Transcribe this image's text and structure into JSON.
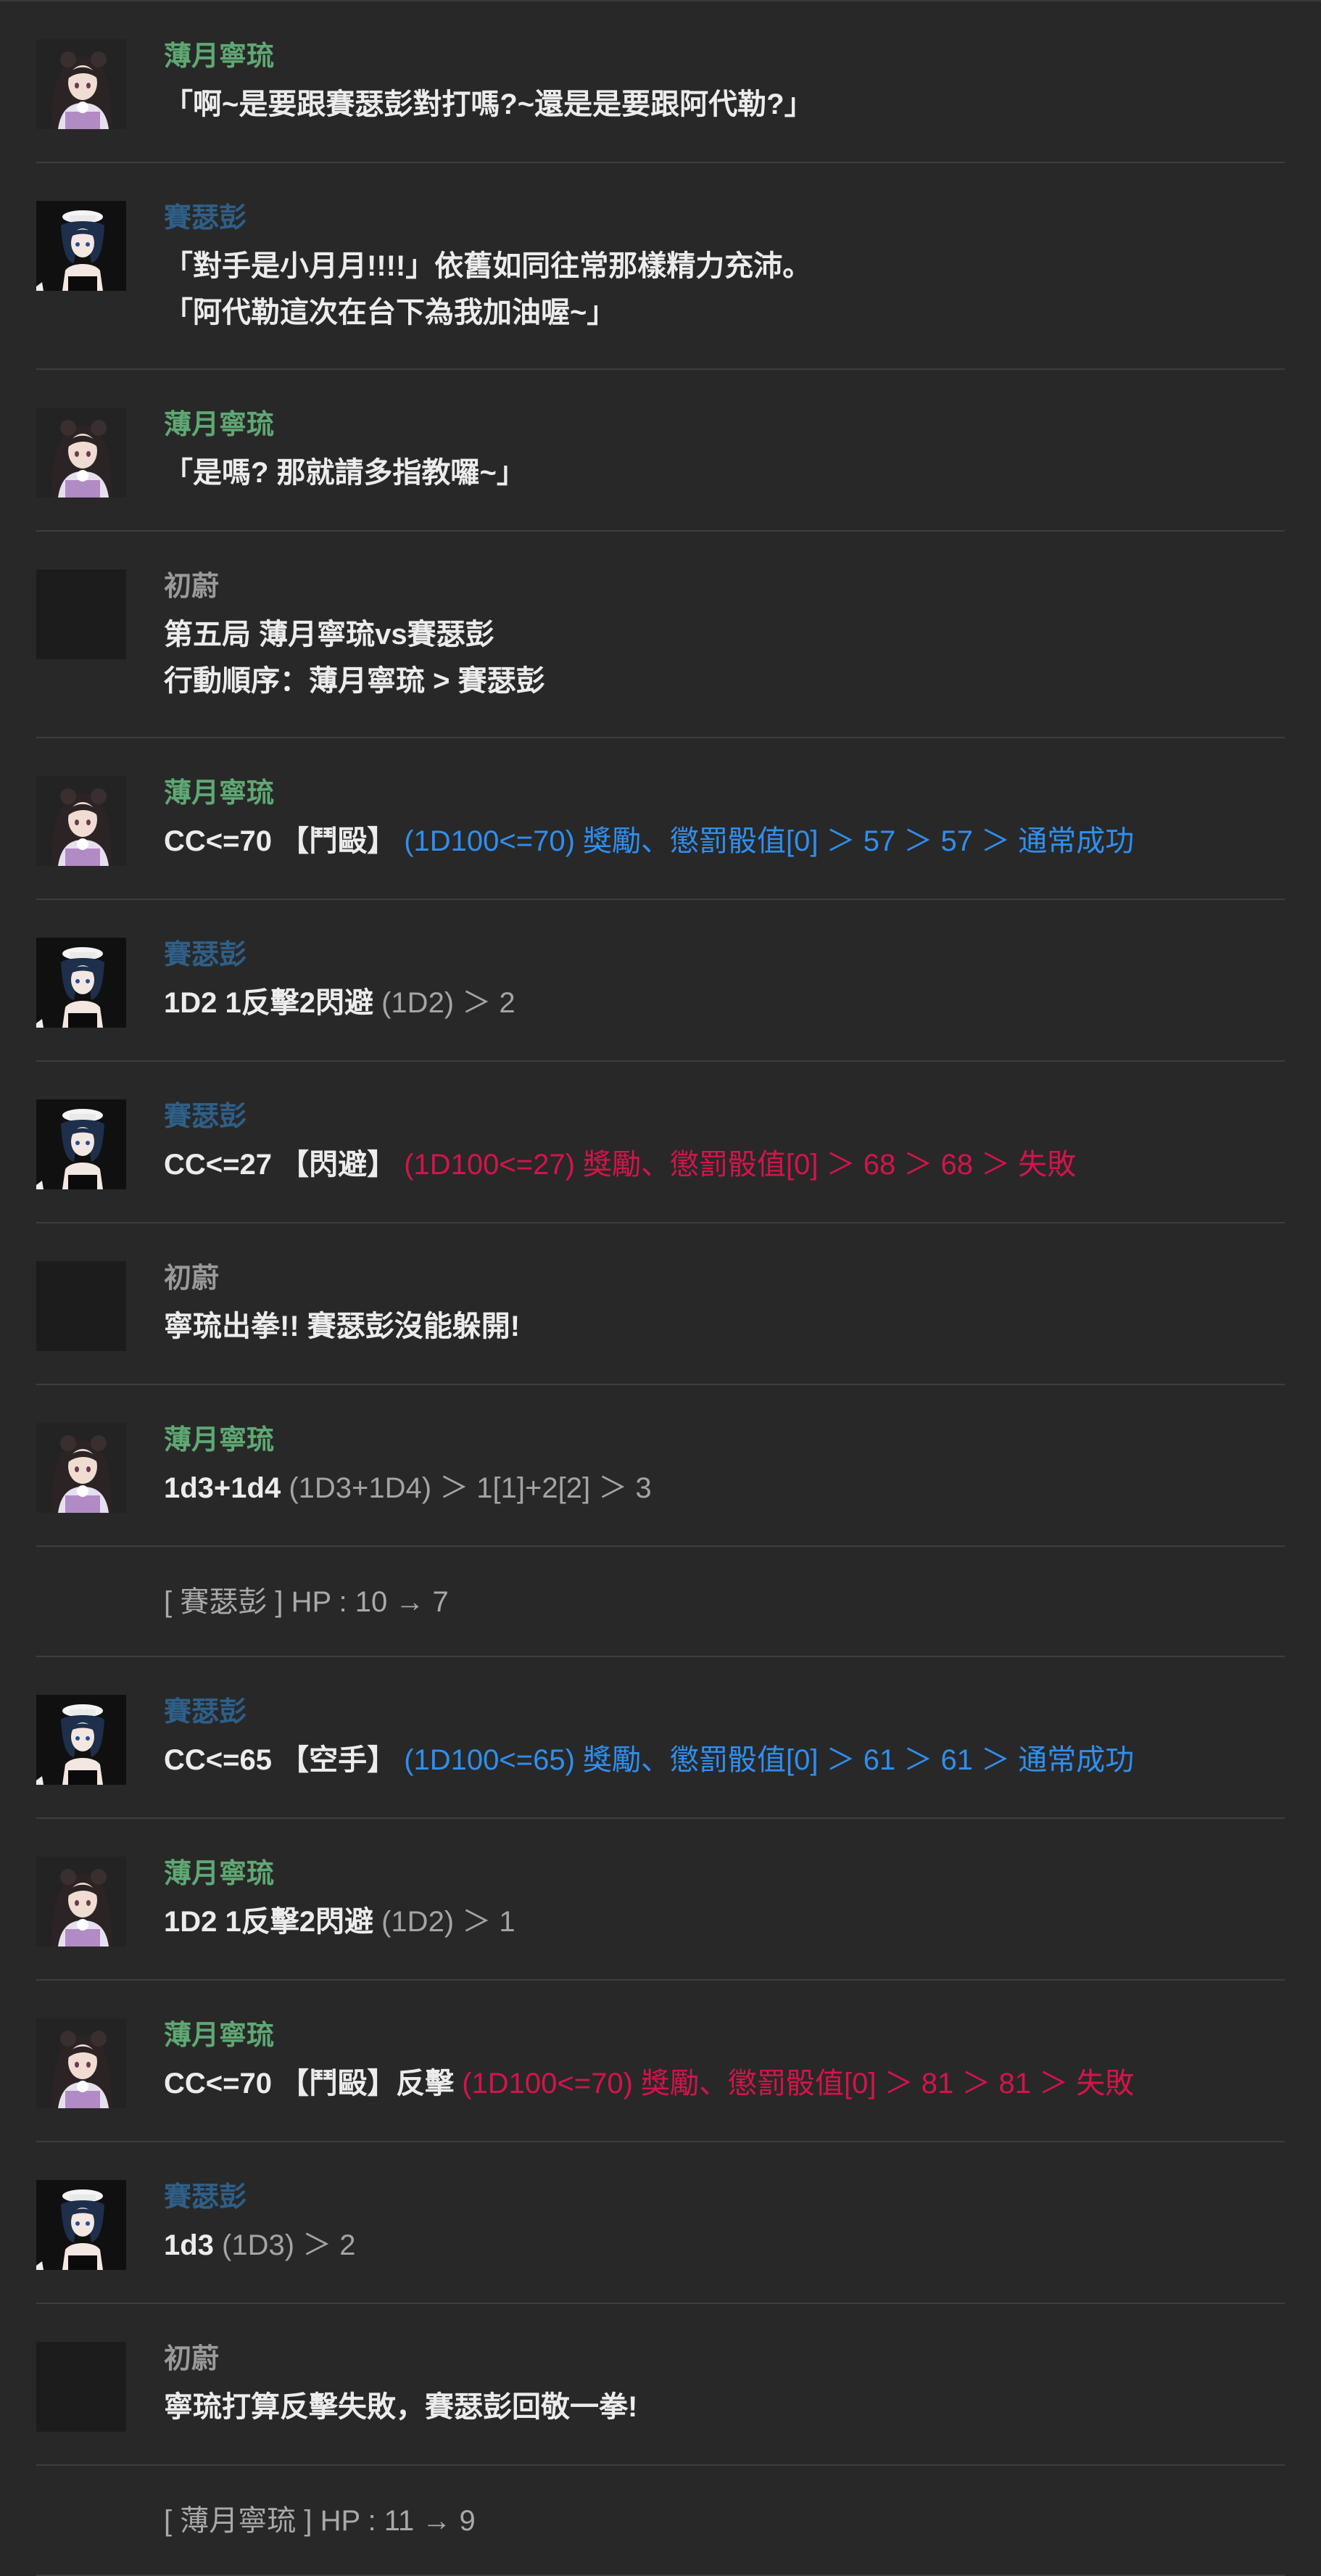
{
  "characters": {
    "ningliu": {
      "name": "薄月寧琉",
      "color": "#5fa873"
    },
    "saiseipeng": {
      "name": "賽瑟彭",
      "color": "#2e5f88"
    },
    "kp": {
      "name": "初蔚",
      "color": "#9a9a9a"
    }
  },
  "messages": [
    {
      "type": "chat",
      "speaker": "ningliu",
      "lines": [
        [
          {
            "text": "「啊~是要跟賽瑟彭對打嗎?~還是是要跟阿代勒?」"
          }
        ]
      ]
    },
    {
      "type": "chat",
      "speaker": "saiseipeng",
      "lines": [
        [
          {
            "text": "「對手是小月月!!!!」依舊如同往常那樣精力充沛。"
          }
        ],
        [
          {
            "text": "「阿代勒這次在台下為我加油喔~」"
          }
        ]
      ]
    },
    {
      "type": "chat",
      "speaker": "ningliu",
      "lines": [
        [
          {
            "text": "「是嗎? 那就請多指教囉~」"
          }
        ]
      ]
    },
    {
      "type": "chat",
      "speaker": "kp",
      "lines": [
        [
          {
            "text": "第五局 薄月寧琉vs賽瑟彭"
          }
        ],
        [
          {
            "text": "行動順序：薄月寧琉 > 賽瑟彭"
          }
        ]
      ]
    },
    {
      "type": "chat",
      "speaker": "ningliu",
      "lines": [
        [
          {
            "text": "CC<=70 【鬥毆】 "
          },
          {
            "text": "(1D100<=70) 獎勵、懲罰骰值[0] ＞ 57 ＞ 57 ＞ 通常成功",
            "style": "blue"
          }
        ]
      ]
    },
    {
      "type": "chat",
      "speaker": "saiseipeng",
      "lines": [
        [
          {
            "text": "1D2 1反擊2閃避 "
          },
          {
            "text": "(1D2) ＞ 2",
            "style": "gray"
          }
        ]
      ]
    },
    {
      "type": "chat",
      "speaker": "saiseipeng",
      "lines": [
        [
          {
            "text": "CC<=27 【閃避】 "
          },
          {
            "text": "(1D100<=27) 獎勵、懲罰骰值[0] ＞ 68 ＞ 68 ＞ 失敗",
            "style": "red"
          }
        ]
      ]
    },
    {
      "type": "chat",
      "speaker": "kp",
      "lines": [
        [
          {
            "text": "寧琉出拳!! 賽瑟彭沒能躲開!"
          }
        ]
      ]
    },
    {
      "type": "chat",
      "speaker": "ningliu",
      "lines": [
        [
          {
            "text": "1d3+1d4 "
          },
          {
            "text": "(1D3+1D4) ＞ 1[1]+2[2] ＞ 3",
            "style": "gray"
          }
        ]
      ]
    },
    {
      "type": "system",
      "text": "[ 賽瑟彭 ] HP : 10 → 7"
    },
    {
      "type": "chat",
      "speaker": "saiseipeng",
      "lines": [
        [
          {
            "text": "CC<=65 【空手】 "
          },
          {
            "text": "(1D100<=65) 獎勵、懲罰骰值[0] ＞ 61 ＞ 61 ＞ 通常成功",
            "style": "blue"
          }
        ]
      ]
    },
    {
      "type": "chat",
      "speaker": "ningliu",
      "lines": [
        [
          {
            "text": "1D2 1反擊2閃避 "
          },
          {
            "text": "(1D2) ＞ 1",
            "style": "gray"
          }
        ]
      ]
    },
    {
      "type": "chat",
      "speaker": "ningliu",
      "lines": [
        [
          {
            "text": "CC<=70 【鬥毆】反擊 "
          },
          {
            "text": "(1D100<=70) 獎勵、懲罰骰值[0] ＞ 81 ＞ 81 ＞ 失敗",
            "style": "red"
          }
        ]
      ]
    },
    {
      "type": "chat",
      "speaker": "saiseipeng",
      "lines": [
        [
          {
            "text": "1d3 "
          },
          {
            "text": "(1D3) ＞ 2",
            "style": "gray"
          }
        ]
      ]
    },
    {
      "type": "chat",
      "speaker": "kp",
      "lines": [
        [
          {
            "text": "寧琉打算反擊失敗，賽瑟彭回敬一拳!"
          }
        ]
      ]
    },
    {
      "type": "system",
      "text": "[ 薄月寧琉 ] HP : 11 → 9"
    }
  ]
}
